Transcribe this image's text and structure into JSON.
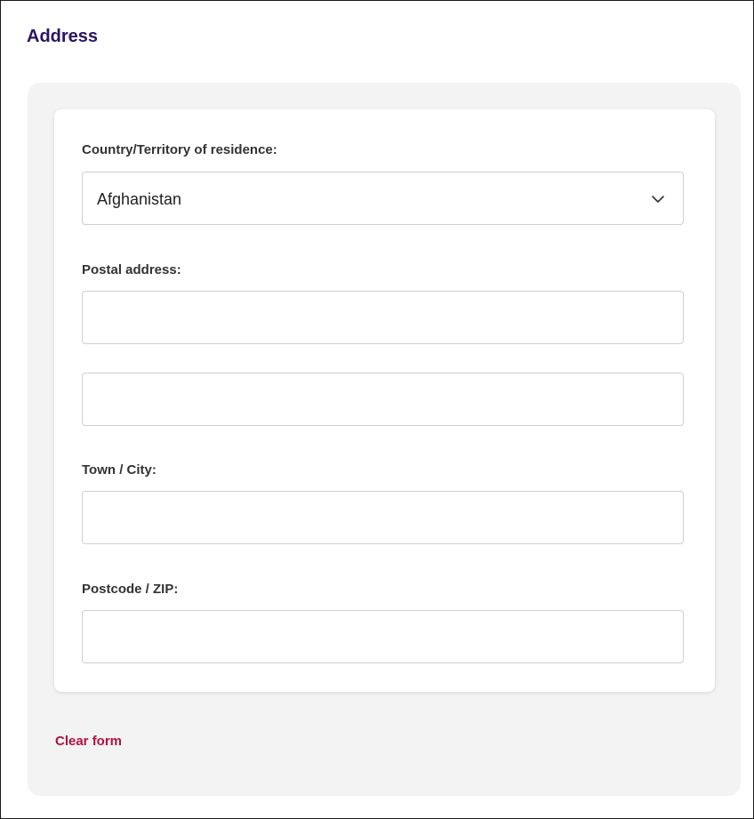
{
  "section": {
    "title": "Address"
  },
  "form": {
    "country": {
      "label": "Country/Territory of residence:",
      "selected": "Afghanistan"
    },
    "postal_address": {
      "label": "Postal address:",
      "line1_value": "",
      "line2_value": ""
    },
    "town_city": {
      "label": "Town / City:",
      "value": ""
    },
    "postcode": {
      "label": "Postcode / ZIP:",
      "value": ""
    }
  },
  "actions": {
    "clear_label": "Clear form"
  },
  "colors": {
    "title": "#2b1462",
    "clear_link": "#b0123f",
    "panel_bg": "#f3f3f3",
    "field_border": "#cfcfcf"
  },
  "icons": {
    "select_chevron": "chevron-down-icon"
  }
}
